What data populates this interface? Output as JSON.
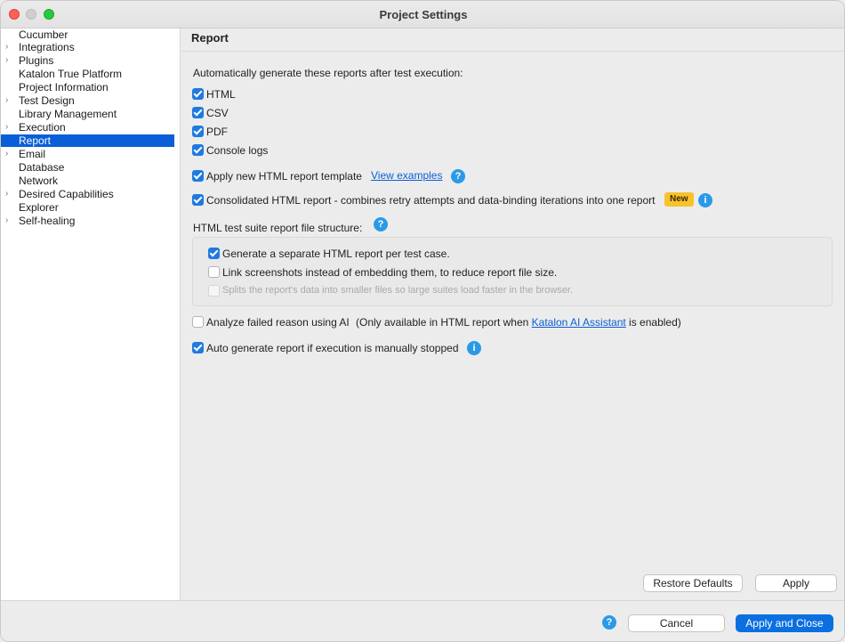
{
  "window": {
    "title": "Project Settings"
  },
  "sidebar": {
    "items": [
      {
        "label": "Cucumber",
        "expandable": false,
        "selected": false
      },
      {
        "label": "Integrations",
        "expandable": true,
        "selected": false
      },
      {
        "label": "Plugins",
        "expandable": true,
        "selected": false
      },
      {
        "label": "Katalon True Platform",
        "expandable": false,
        "selected": false
      },
      {
        "label": "Project Information",
        "expandable": false,
        "selected": false
      },
      {
        "label": "Test Design",
        "expandable": true,
        "selected": false
      },
      {
        "label": "Library Management",
        "expandable": false,
        "selected": false
      },
      {
        "label": "Execution",
        "expandable": true,
        "selected": false
      },
      {
        "label": "Report",
        "expandable": false,
        "selected": true
      },
      {
        "label": "Email",
        "expandable": true,
        "selected": false
      },
      {
        "label": "Database",
        "expandable": false,
        "selected": false
      },
      {
        "label": "Network",
        "expandable": false,
        "selected": false
      },
      {
        "label": "Desired Capabilities",
        "expandable": true,
        "selected": false
      },
      {
        "label": "Explorer",
        "expandable": false,
        "selected": false
      },
      {
        "label": "Self-healing",
        "expandable": true,
        "selected": false
      }
    ]
  },
  "report": {
    "page_title": "Report",
    "auto_generate_label": "Automatically generate these reports after test execution:",
    "formats": [
      {
        "label": "HTML",
        "checked": true
      },
      {
        "label": "CSV",
        "checked": true
      },
      {
        "label": "PDF",
        "checked": true
      },
      {
        "label": "Console logs",
        "checked": true
      }
    ],
    "new_template": {
      "label": "Apply new HTML report template",
      "checked": true,
      "link": "View examples"
    },
    "consolidated": {
      "label": "Consolidated HTML report - combines retry attempts and data-binding iterations into one report",
      "checked": true,
      "badge": "New"
    },
    "structure_label": "HTML test suite report file structure:",
    "structure_options": [
      {
        "label": "Generate a separate HTML report per test case.",
        "checked": true,
        "enabled": true
      },
      {
        "label": "Link screenshots instead of embedding them, to reduce report file size.",
        "checked": false,
        "enabled": true
      },
      {
        "label": "Splits the report's data into smaller files so large suites load faster in the browser.",
        "checked": false,
        "enabled": false
      }
    ],
    "ai_analyze": {
      "label": "Analyze failed reason using AI",
      "checked": false,
      "note_prefix": "(Only available in HTML report when ",
      "note_link": "Katalon AI Assistant",
      "note_suffix": " is enabled)"
    },
    "auto_stop": {
      "label": "Auto generate report if execution is manually stopped",
      "checked": true
    }
  },
  "buttons": {
    "restore_defaults": "Restore Defaults",
    "apply": "Apply",
    "cancel": "Cancel",
    "apply_and_close": "Apply and Close"
  },
  "icons": {
    "help": "?",
    "info": "i",
    "chevron": "›"
  },
  "colors": {
    "accent": "#0b6fe0",
    "selection": "#0a5fd6",
    "badge": "#f8c22c",
    "help_icon": "#2a9ae8"
  }
}
